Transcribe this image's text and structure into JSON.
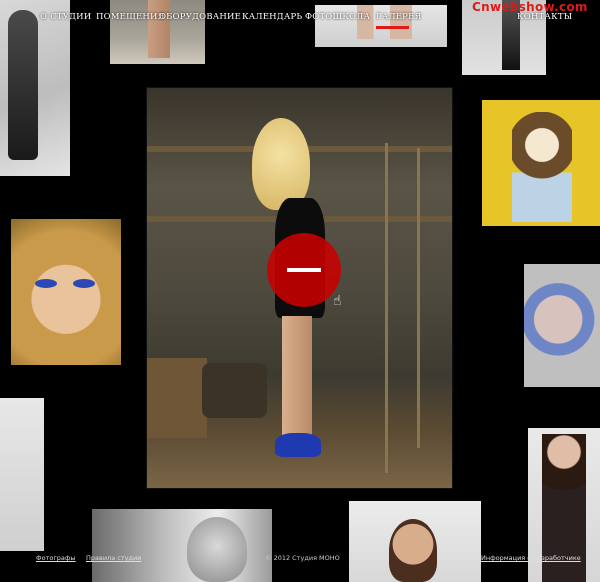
{
  "watermark": "Cnwebshow.com",
  "nav": {
    "items": [
      {
        "label": "О СТУДИИ"
      },
      {
        "label": "ПОМЕЩЕНИЯ"
      },
      {
        "label": "ОБОРУДОВАНИЕ"
      },
      {
        "label": "КАЛЕНДАРЬ"
      },
      {
        "label": "ФОТОШКОЛА"
      },
      {
        "label": "ГАЛЕРЕЯ"
      },
      {
        "label": "КОНТАКТЫ"
      }
    ],
    "active": "ГАЛЕРЕЯ",
    "accent_color": "#e01919"
  },
  "gallery": {
    "toggle_icon": "minus-icon",
    "toggle_color": "#c80000",
    "cursor_icon": "hand-pointer-icon"
  },
  "footer": {
    "photographers": "Фотографы",
    "rules": "Правила студии",
    "copyright": "© 2012  Студия МОНО",
    "info": "Информация о разработчике"
  }
}
